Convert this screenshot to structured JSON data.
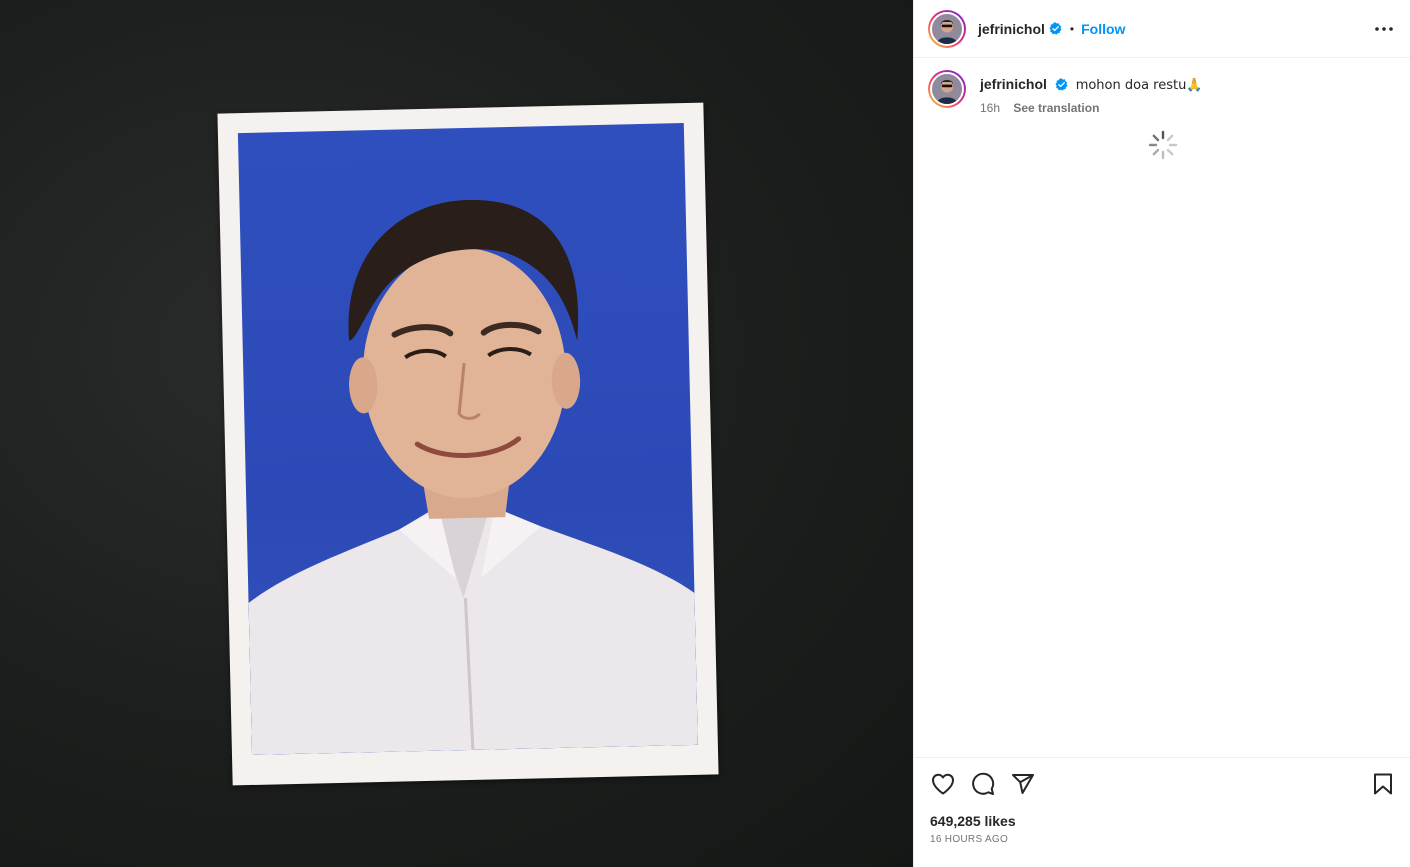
{
  "post": {
    "author": {
      "username": "jefrinichol",
      "verified": true,
      "follow_label": "Follow",
      "separator": "•"
    },
    "caption": {
      "username": "jefrinichol",
      "text": "mohon doa restu🙏",
      "relative_time": "16h",
      "translate_label": "See translation"
    },
    "likes": "649,285 likes",
    "timestamp": "16 HOURS AGO"
  },
  "colors": {
    "accent": "#0095f6",
    "verified": "#0095f6",
    "media_background": "#1d1f1e",
    "photo_backdrop": "#2f4fbf"
  },
  "icons": {
    "header_more": "more-horizontal-icon",
    "verified": "verified-badge-icon",
    "like": "heart-icon",
    "comment": "comment-bubble-icon",
    "share": "paper-plane-icon",
    "save": "bookmark-icon",
    "loading": "loading-spinner-icon"
  }
}
